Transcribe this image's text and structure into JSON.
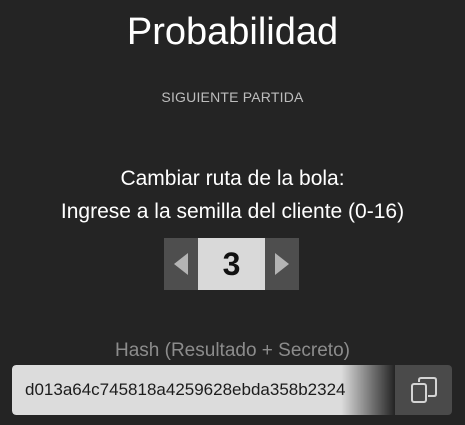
{
  "header": {
    "title": "Probabilidad",
    "subtitle": "SIGUIENTE PARTIDA"
  },
  "instructions": {
    "line1": "Cambiar ruta de la bola:",
    "line2": "Ingrese a la semilla del cliente (0-16)"
  },
  "stepper": {
    "value": "3",
    "decrement_icon": "triangle-left-icon",
    "increment_icon": "triangle-right-icon"
  },
  "hash": {
    "label": "Hash (Resultado + Secreto)",
    "value": "d013a64c745818a4259628ebda358b2324",
    "copy_icon": "copy-icon"
  },
  "colors": {
    "background": "#242424",
    "button_dark": "#4e4e4e",
    "field_light": "#d9d9d9",
    "muted_text": "#8c8c8c"
  }
}
